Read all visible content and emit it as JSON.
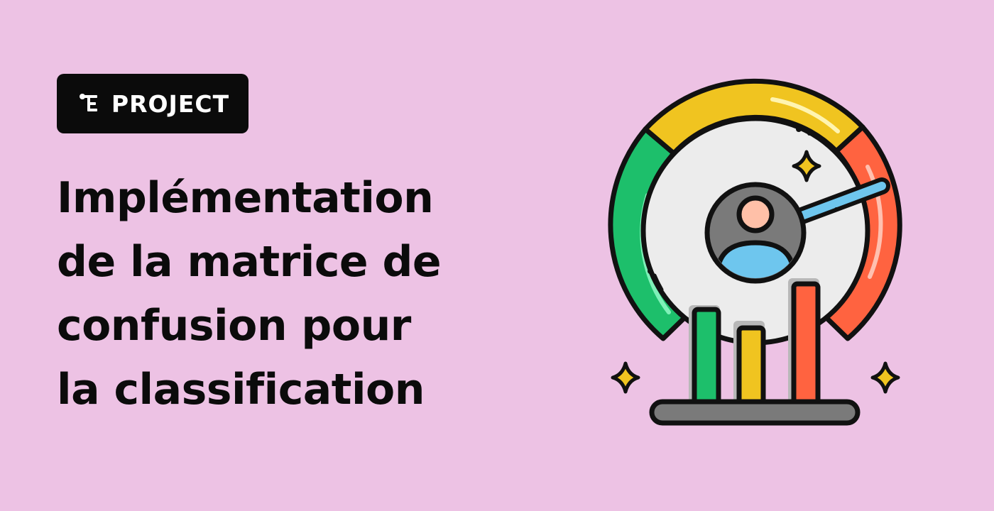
{
  "badge": {
    "label": "PROJECT",
    "icon": "flowchart-icon"
  },
  "title": {
    "lines": [
      "Implémentation",
      "de la matrice de",
      "confusion pour",
      "la classification"
    ]
  },
  "illustration": {
    "icon": "performance-gauge-icon",
    "colors": {
      "green": "#1dbf6b",
      "yellow": "#f0c420",
      "red": "#ff6340",
      "needle": "#6ec6ee",
      "avatar_body": "#6ec6ee",
      "avatar_face": "#ffc0a8",
      "base": "#7a7a7a"
    }
  },
  "colors": {
    "background": "#edc2e4",
    "badge_bg": "#0b0b0b",
    "text": "#0b0b0b"
  }
}
